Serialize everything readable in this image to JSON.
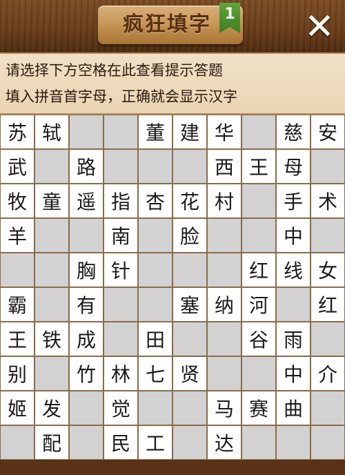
{
  "header": {
    "title": "疯狂填字",
    "level": "1",
    "close_glyph": "✕"
  },
  "hint": {
    "line1": "请选择下方空格在此查看提示答题",
    "line2": "填入拼音首字母，正确就会显示汉字"
  },
  "grid": [
    [
      "苏",
      "轼",
      "",
      "",
      "董",
      "建",
      "华",
      "",
      "慈",
      "安"
    ],
    [
      "武",
      "",
      "路",
      "",
      "",
      "",
      "西",
      "王",
      "母",
      ""
    ],
    [
      "牧",
      "童",
      "遥",
      "指",
      "杏",
      "花",
      "村",
      "",
      "手",
      "术"
    ],
    [
      "羊",
      "",
      "",
      "南",
      "",
      "脸",
      "",
      "",
      "中",
      ""
    ],
    [
      "",
      "",
      "胸",
      "针",
      "",
      "",
      "",
      "红",
      "线",
      "女"
    ],
    [
      "霸",
      "",
      "有",
      "",
      "",
      "塞",
      "纳",
      "河",
      "",
      "红"
    ],
    [
      "王",
      "铁",
      "成",
      "",
      "田",
      "",
      "",
      "谷",
      "雨",
      ""
    ],
    [
      "别",
      "",
      "竹",
      "林",
      "七",
      "贤",
      "",
      "",
      "中",
      "介"
    ],
    [
      "姬",
      "发",
      "",
      "觉",
      "",
      "",
      "马",
      "赛",
      "曲",
      ""
    ],
    [
      "",
      "配",
      "",
      "民",
      "工",
      "",
      "达",
      "",
      "",
      ""
    ]
  ]
}
